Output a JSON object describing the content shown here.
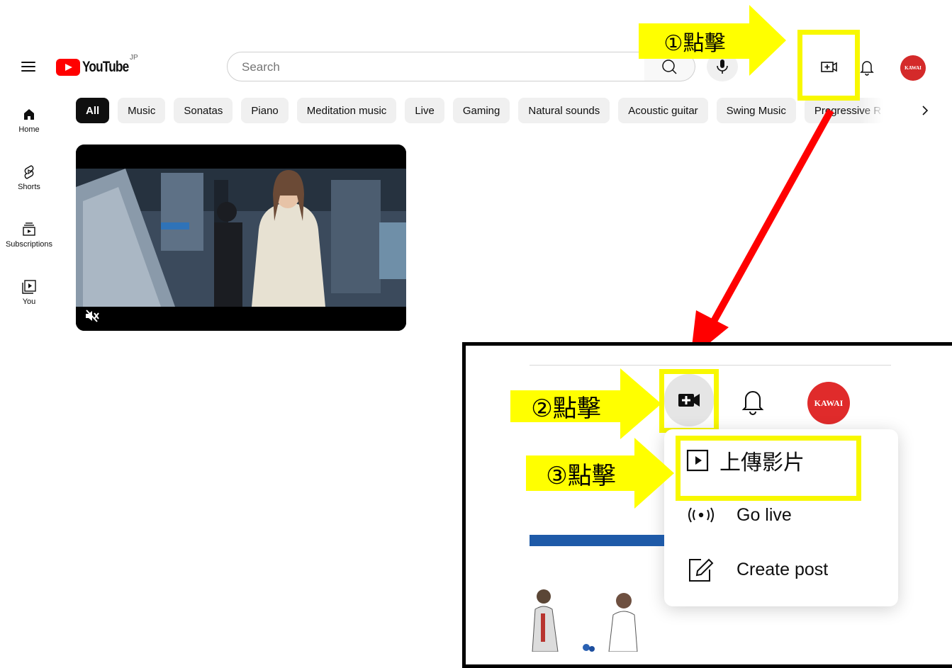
{
  "header": {
    "logo_text": "YouTube",
    "region": "JP",
    "search_placeholder": "Search",
    "avatar_text": "KAWAI"
  },
  "sidebar": {
    "items": [
      {
        "label": "Home",
        "icon": "home-icon"
      },
      {
        "label": "Shorts",
        "icon": "shorts-icon"
      },
      {
        "label": "Subscriptions",
        "icon": "subscriptions-icon"
      },
      {
        "label": "You",
        "icon": "you-icon"
      }
    ]
  },
  "chips": [
    "All",
    "Music",
    "Sonatas",
    "Piano",
    "Meditation music",
    "Live",
    "Gaming",
    "Natural sounds",
    "Acoustic guitar",
    "Swing Music",
    "Progressive R"
  ],
  "video": {
    "muted": true
  },
  "annotations": {
    "step1": "①點擊",
    "step2": "②點擊",
    "step3": "③點擊",
    "highlight_color": "#ffff00",
    "arrow_color": "#ff0000"
  },
  "create_menu": {
    "avatar_text": "KAWAI",
    "items": [
      {
        "label": "上傳影片",
        "icon": "upload-video-icon"
      },
      {
        "label": "Go live",
        "icon": "live-broadcast-icon"
      },
      {
        "label": "Create post",
        "icon": "create-post-icon"
      }
    ]
  }
}
